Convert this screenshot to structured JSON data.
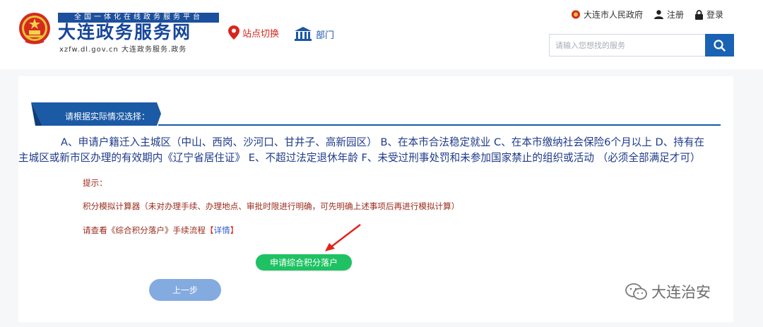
{
  "header": {
    "ribbon_text": "全国一体化在线政务服务平台",
    "site_title": "大连政务服务网",
    "site_url": "xzfw.dl.gov.cn 大连政务服务.政务",
    "station_switch": "站点切换",
    "department": "部门",
    "top_links": {
      "gov": "大连市人民政府",
      "register": "注册",
      "login": "登录"
    },
    "search": {
      "placeholder": "请输入您想找的服务"
    }
  },
  "main": {
    "section_title": "请根据实际情况选择：",
    "conditions_line1": "A、申请户籍迁入主城区（中山、西岗、沙河口、甘井子、高新园区） B、在本市合法稳定就业 C、在本市缴纳社会保险6个月以上 D、持有在",
    "conditions_line2": "主城区或新市区办理的有效期内《辽宁省居住证》 E、不超过法定退休年龄 F、未受过刑事处罚和未参加国家禁止的组织或活动 （必须全部满足才可）",
    "hint_label": "提示：",
    "hint_calculator": "积分模拟计算器（未对办理手续、办理地点、审批时限进行明确，可先明确上述事项后再进行模拟计算）",
    "hint_process_prefix": "请查看《综合积分落户》手续流程",
    "hint_bracket_open": "【",
    "hint_detail_link": "详情",
    "hint_bracket_close": "】",
    "apply_button": "申请综合积分落户",
    "prev_button": "上一步"
  },
  "watermark": {
    "text": "大连治安"
  },
  "colors": {
    "brand_blue": "#1a62b3",
    "apply_green": "#1ec262",
    "prev_blue": "#84abe0",
    "hint_red": "#9b2b1c"
  }
}
